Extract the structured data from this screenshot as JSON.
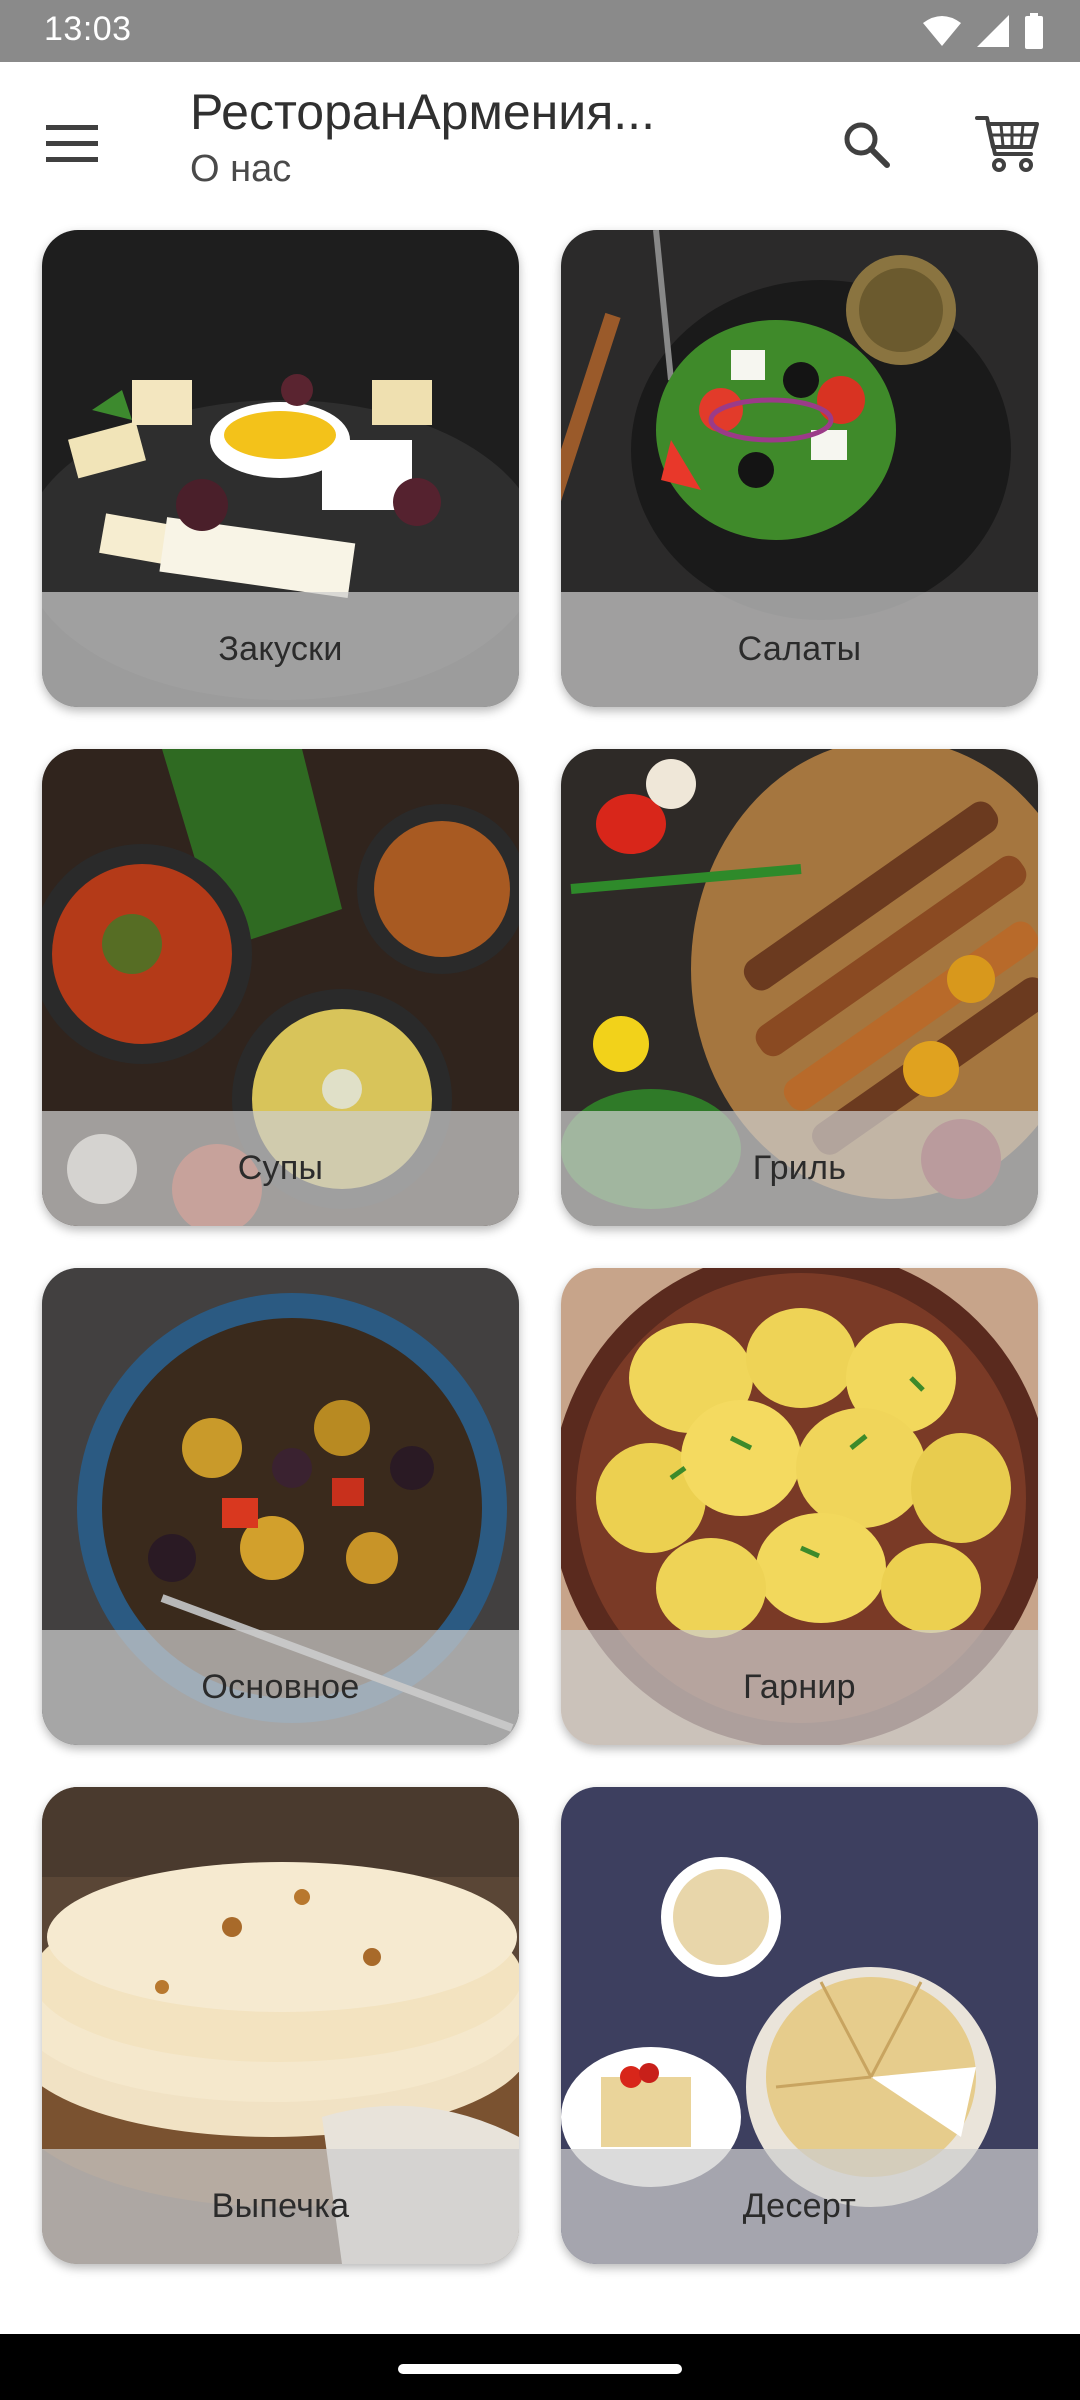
{
  "status_bar": {
    "time": "13:03",
    "icons": [
      "wifi-icon",
      "signal-icon",
      "battery-icon"
    ]
  },
  "app_bar": {
    "title": "РесторанАрмения...",
    "subtitle": "О нас",
    "menu_icon": "menu-icon",
    "search_icon": "search-icon",
    "cart_icon": "cart-icon"
  },
  "categories": [
    {
      "label": "Закуски",
      "image": "cheese-platter"
    },
    {
      "label": "Салаты",
      "image": "greek-salad"
    },
    {
      "label": "Супы",
      "image": "soups"
    },
    {
      "label": "Гриль",
      "image": "grilled-skewers"
    },
    {
      "label": "Основное",
      "image": "vegetable-stew"
    },
    {
      "label": "Гарнир",
      "image": "boiled-potatoes"
    },
    {
      "label": "Выпечка",
      "image": "lavash-flatbread"
    },
    {
      "label": "Десерт",
      "image": "napoleon-cake"
    }
  ],
  "colors": {
    "status_bar": "#8a8a8a",
    "label_overlay": "#cdcdcd",
    "text": "#303030"
  }
}
